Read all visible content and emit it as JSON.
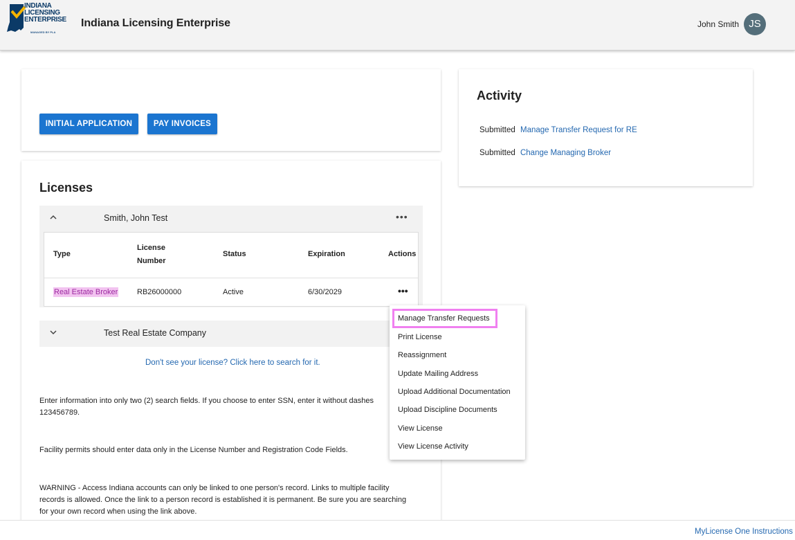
{
  "header": {
    "logo_text_1": "INDIANA",
    "logo_text_2": "LICENSING",
    "logo_text_3": "ENTERPRISE",
    "logo_sub": "MANAGED BY PLA",
    "app_title": "Indiana Licensing Enterprise",
    "user_name": "John Smith",
    "avatar_initials": "JS"
  },
  "actions": {
    "initial_label": "INITIAL APPLICATION",
    "pay_label": "PAY INVOICES"
  },
  "activity": {
    "title": "Activity",
    "items": [
      {
        "status": "Submitted",
        "link": "Manage Transfer Request for RE"
      },
      {
        "status": "Submitted",
        "link": "Change Managing Broker"
      }
    ]
  },
  "licenses": {
    "title": "Licenses",
    "holders": [
      {
        "name": "Smith, John Test"
      },
      {
        "name": "Test Real Estate Company"
      }
    ],
    "columns": {
      "type": "Type",
      "license_number_1": "License",
      "license_number_2": "Number",
      "status": "Status",
      "expiration": "Expiration",
      "actions": "Actions"
    },
    "row": {
      "type": "Real Estate Broker",
      "license_number": "RB26000000",
      "status": "Active",
      "expiration": "6/30/2029"
    },
    "search_link": "Don't see your license? Click here to search for it.",
    "info_1": "Enter information into only two (2) search fields. If you choose to enter SSN, enter it without dashes 123456789.",
    "info_2": "Facility permits should enter data only in the License Number and Registration Code Fields.",
    "info_3": "WARNING - Access Indiana accounts can only be linked to one person's record. Links to multiple facility records is allowed. Once the link to a person record is established it is permanent. Be sure you are searching for your own record when using the link above."
  },
  "menu": {
    "items": [
      "Manage Transfer Requests",
      "Print License",
      "Reassignment",
      "Update Mailing Address",
      "Upload Additional Documentation",
      "Upload Discipline Documents",
      "View License",
      "View License Activity"
    ]
  },
  "footer": {
    "link": "MyLicense One Instructions"
  },
  "colors": {
    "primary_button": "#1b75d0",
    "link": "#2468b0",
    "highlight_border": "#f080f0",
    "highlight_fill": "#f2c3f0",
    "avatar": "#546e7a"
  }
}
